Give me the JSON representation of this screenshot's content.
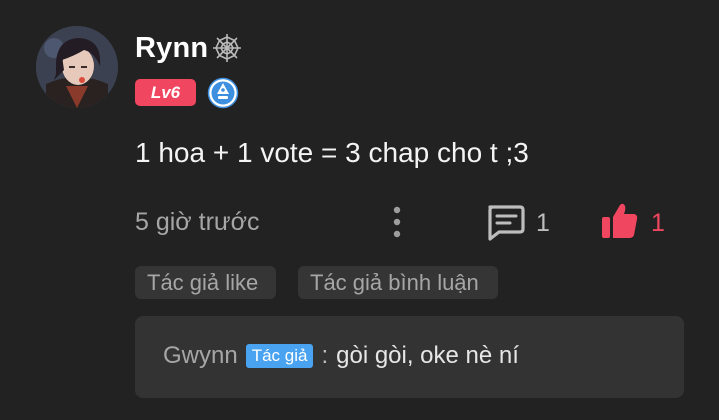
{
  "comment": {
    "username": "Rynn",
    "level": "Lv6",
    "text": "1 hoa + 1 vote = 3 chap cho t ;3",
    "time": "5 giờ trước",
    "reply_count": "1",
    "like_count": "1",
    "icons": {
      "avatar": "avatar",
      "decoration": "spider-web-icon",
      "verified": "verified-badge-icon",
      "more": "more-vertical-icon",
      "reply": "comment-icon",
      "like": "thumbs-up-icon"
    }
  },
  "tags": [
    "Tác giả like",
    "Tác giả bình luận"
  ],
  "reply": {
    "author": "Gwynn",
    "badge": "Tác giả",
    "separator": ":",
    "text": "gòi gòi, oke nè ní"
  },
  "colors": {
    "background": "#222222",
    "accent": "#f0465f",
    "author_badge": "#4aa3f0",
    "muted_text": "#a6a6a6",
    "tag_bg": "#353535",
    "reply_bg": "#333333"
  }
}
